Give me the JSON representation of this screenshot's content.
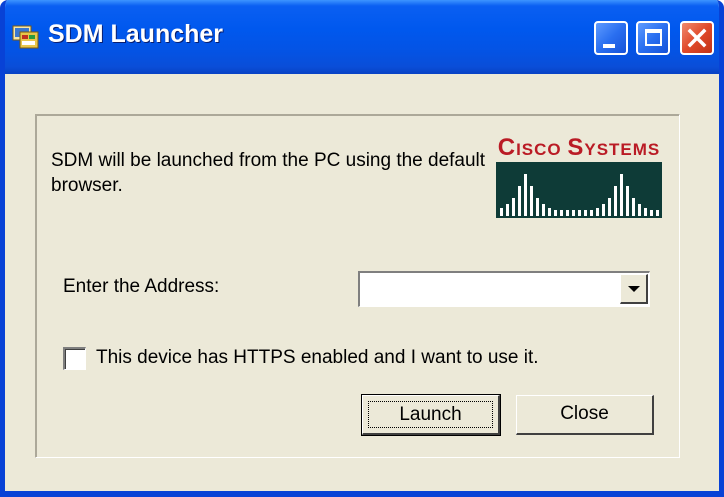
{
  "window": {
    "title": "SDM Launcher",
    "icon": "sdm-app-icon"
  },
  "titlebar_buttons": {
    "minimize": "minimize-icon",
    "maximize": "maximize-icon",
    "close": "close-icon"
  },
  "description": "SDM will be launched from the PC using the default browser.",
  "logo": {
    "text": "Cisco Systems",
    "colors": {
      "text": "#ba1b25",
      "background": "#0e3b37",
      "bars": "#ffffff"
    }
  },
  "address": {
    "label": "Enter the Address:",
    "value": ""
  },
  "https_checkbox": {
    "label": "This device has HTTPS enabled and I want to use it.",
    "checked": false
  },
  "buttons": {
    "launch": "Launch",
    "close": "Close"
  },
  "colors": {
    "titlebar": "#0058ee",
    "dialog_bg": "#ece9d8",
    "close_button": "#e04a2a"
  }
}
